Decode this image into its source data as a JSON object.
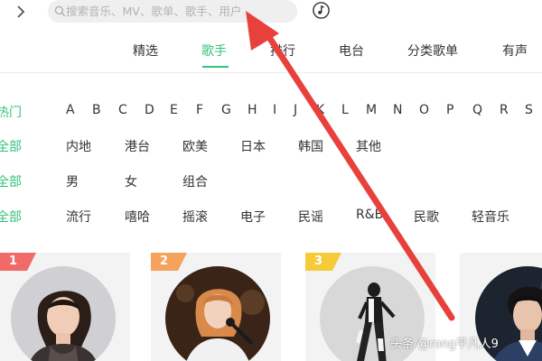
{
  "search": {
    "placeholder": "搜索音乐、MV、歌单、歌手、用户"
  },
  "icons": {
    "forward": "chevron-right-icon",
    "search": "search-icon",
    "music": "music-note-icon"
  },
  "colors": {
    "accent": "#31c27c",
    "arrow": "#e8413c",
    "badge1": "#f06a6a",
    "badge2": "#f4a25c",
    "badge3": "#f5cb3a"
  },
  "tabs": [
    {
      "label": "精选"
    },
    {
      "label": "歌手",
      "active": true
    },
    {
      "label": "排行"
    },
    {
      "label": "电台"
    },
    {
      "label": "分类歌单"
    },
    {
      "label": "有声"
    }
  ],
  "filters": {
    "initial": {
      "head": "热门",
      "options": [
        "A",
        "B",
        "C",
        "D",
        "E",
        "F",
        "G",
        "H",
        "I",
        "J",
        "K",
        "L",
        "M",
        "N",
        "O",
        "P",
        "Q",
        "R",
        "S"
      ]
    },
    "region": {
      "head": "全部",
      "options": [
        "内地",
        "港台",
        "欧美",
        "日本",
        "韩国",
        "其他"
      ]
    },
    "gender": {
      "head": "全部",
      "options": [
        "男",
        "女",
        "组合"
      ]
    },
    "genre": {
      "head": "全部",
      "options": [
        "流行",
        "嘻哈",
        "摇滚",
        "电子",
        "民谣",
        "R&B",
        "民歌",
        "轻音乐"
      ]
    }
  },
  "singers": [
    {
      "rank": "1"
    },
    {
      "rank": "2"
    },
    {
      "rank": "3"
    },
    {
      "rank": ""
    }
  ],
  "watermark": "头条 @rong平凡人9"
}
